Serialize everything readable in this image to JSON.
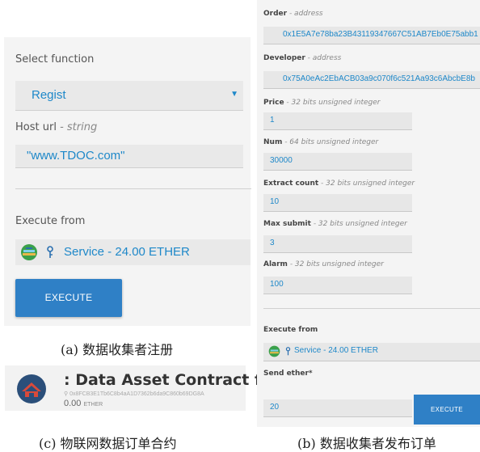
{
  "panel_a": {
    "select_function_label": "Select function",
    "selected_function": "Regist",
    "host_url_label": "Host url",
    "host_url_type": " - string",
    "host_url_value": "\"www.TDOC.com\"",
    "execute_from_label": "Execute from",
    "execute_from_value": "Service - 24.00 ETHER",
    "execute_button": "EXECUTE",
    "caption": "(a) 数据收集者注册"
  },
  "panel_b": {
    "order_label": "Order",
    "order_type": " - address",
    "order_value": "0x1E5A7e78ba23B43119347667C51AB7Eb0E75abb1",
    "developer_label": "Developer",
    "developer_type": " - address",
    "developer_value": "0x75A0eAc2EbACB03a9c070f6c521Aa93c6AbcbE8b",
    "price_label": "Price",
    "price_type": " - 32 bits unsigned integer",
    "price_value": "1",
    "num_label": "Num",
    "num_type": " - 64 bits unsigned integer",
    "num_value": "30000",
    "extract_label": "Extract count",
    "extract_type": " - 32 bits unsigned integer",
    "extract_value": "10",
    "max_submit_label": "Max submit",
    "max_submit_type": " - 32 bits unsigned integer",
    "max_submit_value": "3",
    "alarm_label": "Alarm",
    "alarm_type": " - 32 bits unsigned integer",
    "alarm_value": "100",
    "execute_from_label": "Execute from",
    "execute_from_value": "Service - 24.00 ETHER",
    "send_ether_label": "Send ether*",
    "send_ether_value": "20",
    "execute_button": "EXECUTE",
    "caption": "(b) 数据收集者发布订单"
  },
  "panel_c": {
    "title": ": Data Asset Contract ffFC",
    "address": "0x8FCB3E1Tb6C8b4aA1D7362b6da9C860b69DG8A",
    "balance": "0.00",
    "currency": "ETHER",
    "caption": "(c) 物联网数据订单合约"
  },
  "icons": {
    "dropdown": "dropdown-arrow-icon",
    "identicon": "identicon-icon",
    "key": "key-icon",
    "contract_avatar": "contract-avatar-icon"
  },
  "colors": {
    "accent": "#1e88c9",
    "button": "#2f80c6",
    "panel_bg": "#f4f4f4"
  }
}
